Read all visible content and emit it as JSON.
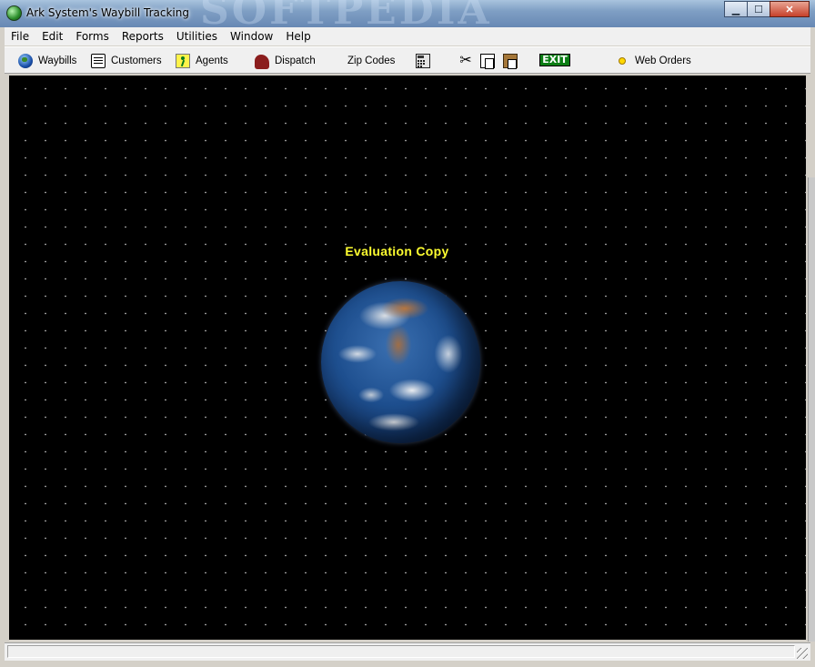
{
  "window": {
    "title": "Ark System's Waybill Tracking",
    "watermark": "SOFTPEDIA",
    "controls": {
      "minimize": "▁",
      "maximize": "☐",
      "close": "✕"
    }
  },
  "menu": [
    "File",
    "Edit",
    "Forms",
    "Reports",
    "Utilities",
    "Window",
    "Help"
  ],
  "toolbar": {
    "waybills": "Waybills",
    "customers": "Customers",
    "agents": "Agents",
    "dispatch": "Dispatch",
    "zip_codes": "Zip Codes",
    "exit": "EXIT",
    "web_orders": "Web Orders"
  },
  "icons": {
    "waybills": "globe-icon",
    "customers": "address-book-icon",
    "agents": "running-man-icon",
    "dispatch": "truck-icon",
    "calculator": "calculator-icon",
    "cut": "scissors-icon",
    "copy": "copy-icon",
    "paste": "paste-icon",
    "web_orders": "sun-icon"
  },
  "main": {
    "banner": "Evaluation Copy",
    "background": "starfield",
    "image": "earth"
  },
  "status": {
    "text": ""
  },
  "colors": {
    "banner_text": "#ffff30",
    "client_background": "#000000",
    "exit_button": "#0b7d14"
  }
}
